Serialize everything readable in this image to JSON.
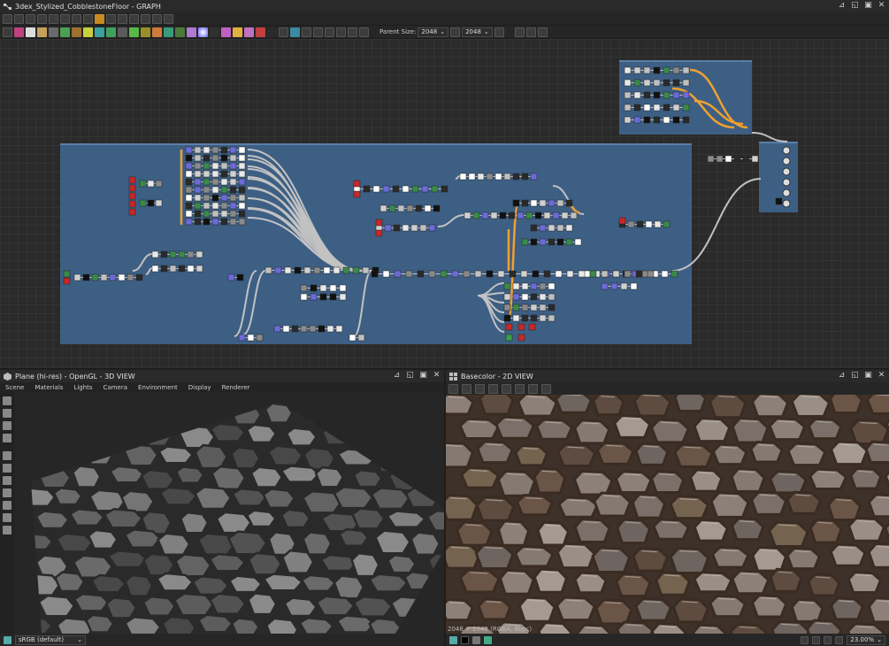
{
  "graph_panel": {
    "title": "3dex_Stylized_CobblestoneFloor - GRAPH",
    "toolbar": {
      "parent_size_label": "Parent Size:",
      "parent_size_value": "2048",
      "size_value": "2048"
    }
  },
  "view3d_panel": {
    "title": "Plane (hi-res) - OpenGL - 3D VIEW",
    "menu": [
      "Scene",
      "Materials",
      "Lights",
      "Camera",
      "Environment",
      "Display",
      "Renderer"
    ],
    "colorspace": "sRGB (default)"
  },
  "view2d_panel": {
    "title": "Basecolor - 2D VIEW",
    "image_info": "2048 × 2048 (RGBA, 8bpc)",
    "zoom": "23.00%"
  },
  "colors": {
    "frame": "#3d5f84",
    "wire_orange": "#f0a030",
    "wire_gray": "#bdbdbd",
    "stone_dark": "#5c5c5c",
    "stone_light": "#8a8a8a",
    "stone_brown": "#6a5546"
  }
}
